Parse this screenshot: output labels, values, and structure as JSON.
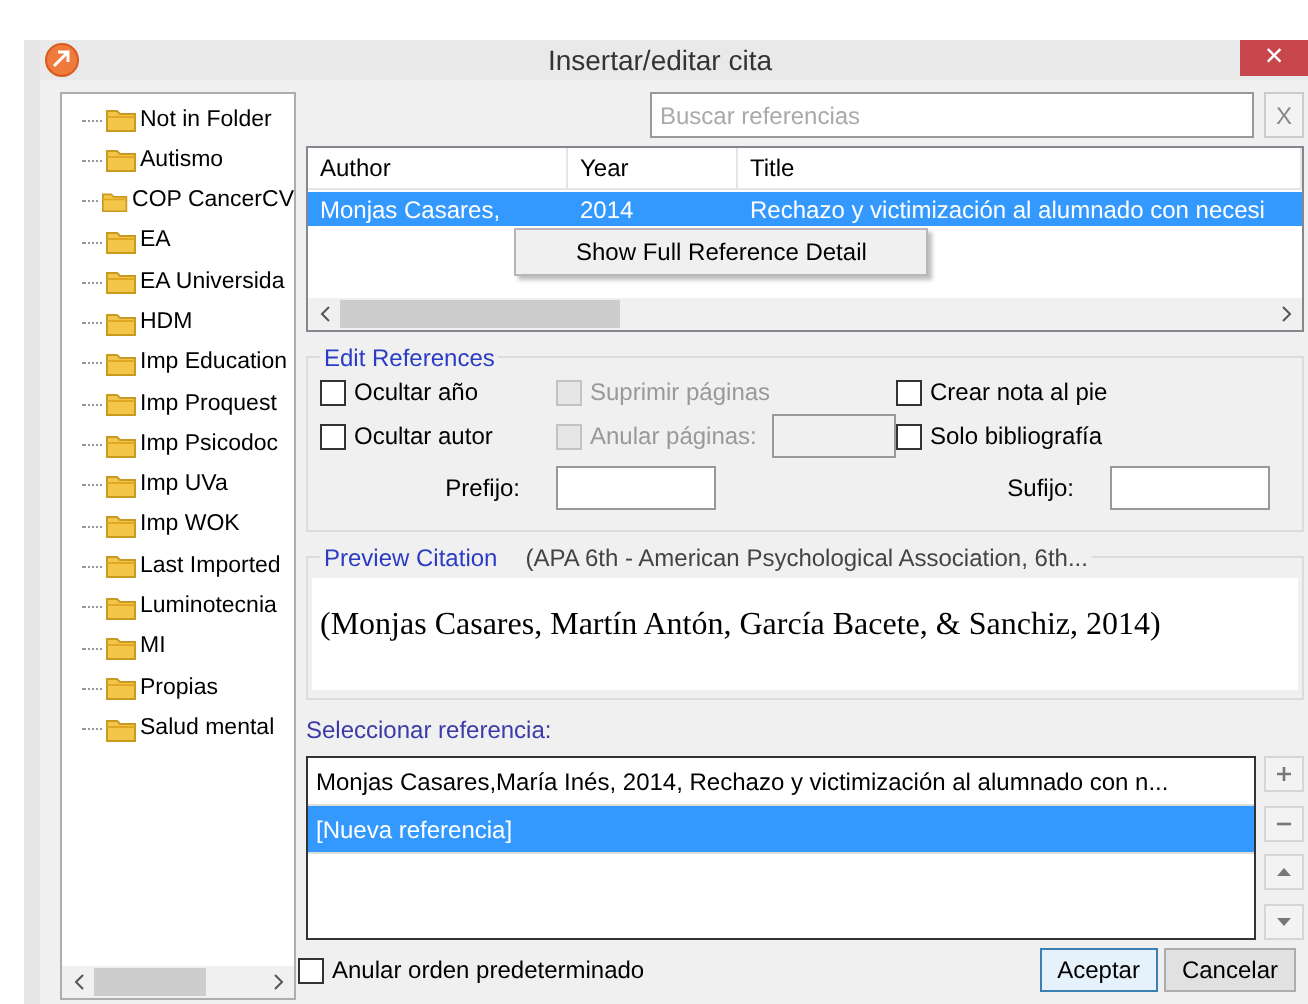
{
  "window": {
    "title": "Insertar/editar cita",
    "close": "×"
  },
  "folders": [
    {
      "label": "Not in Folder"
    },
    {
      "label": "Autismo"
    },
    {
      "label": "COP CancerCV"
    },
    {
      "label": "EA"
    },
    {
      "label": "EA Universida"
    },
    {
      "label": "HDM"
    },
    {
      "label": "Imp Education"
    },
    {
      "label": "Imp Proquest"
    },
    {
      "label": "Imp Psicodoc"
    },
    {
      "label": "Imp UVa"
    },
    {
      "label": "Imp WOK"
    },
    {
      "label": "Last Imported"
    },
    {
      "label": "Luminotecnia"
    },
    {
      "label": "MI"
    },
    {
      "label": "Propias"
    },
    {
      "label": "Salud mental"
    }
  ],
  "search": {
    "placeholder": "Buscar referencias",
    "clear": "X"
  },
  "table": {
    "columns": [
      "Author",
      "Year",
      "Title"
    ],
    "rows": [
      {
        "cells": [
          "Monjas Casares,",
          "2014",
          "Rechazo y victimización al alumnado con necesi"
        ],
        "selected": true
      }
    ]
  },
  "context_menu": {
    "items": [
      "Show Full Reference Detail"
    ]
  },
  "edit_references": {
    "legend": "Edit References",
    "options": [
      {
        "label": "Ocultar año",
        "checked": false,
        "disabled": false
      },
      {
        "label": "Suprimir páginas",
        "checked": false,
        "disabled": true
      },
      {
        "label": "Crear nota al pie",
        "checked": false,
        "disabled": false
      },
      {
        "label": "Ocultar autor",
        "checked": false,
        "disabled": false
      },
      {
        "label": "Anular páginas:",
        "checked": false,
        "disabled": true
      },
      {
        "label": "Solo bibliografía",
        "checked": false,
        "disabled": false
      }
    ],
    "prefix_label": "Prefijo:",
    "suffix_label": "Sufijo:"
  },
  "preview": {
    "legend": "Preview Citation",
    "style": "(APA 6th - American Psychological Association, 6th...",
    "citation": "(Monjas Casares, Martín Antón, García Bacete, & Sanchiz, 2014)"
  },
  "select_label": "Seleccionar referencia:",
  "references": [
    {
      "label": "Monjas Casares,María Inés, 2014, Rechazo y victimización al alumnado con n...",
      "selected": false
    },
    {
      "label": "[Nueva referencia]",
      "selected": true
    }
  ],
  "side_buttons": [
    {
      "kind": "add"
    },
    {
      "kind": "remove"
    },
    {
      "kind": "up"
    },
    {
      "kind": "down"
    }
  ],
  "override_order": {
    "label": "Anular orden predeterminado",
    "checked": false
  },
  "buttons": [
    {
      "label": "Aceptar",
      "default": true
    },
    {
      "label": "Cancelar",
      "default": false
    }
  ]
}
